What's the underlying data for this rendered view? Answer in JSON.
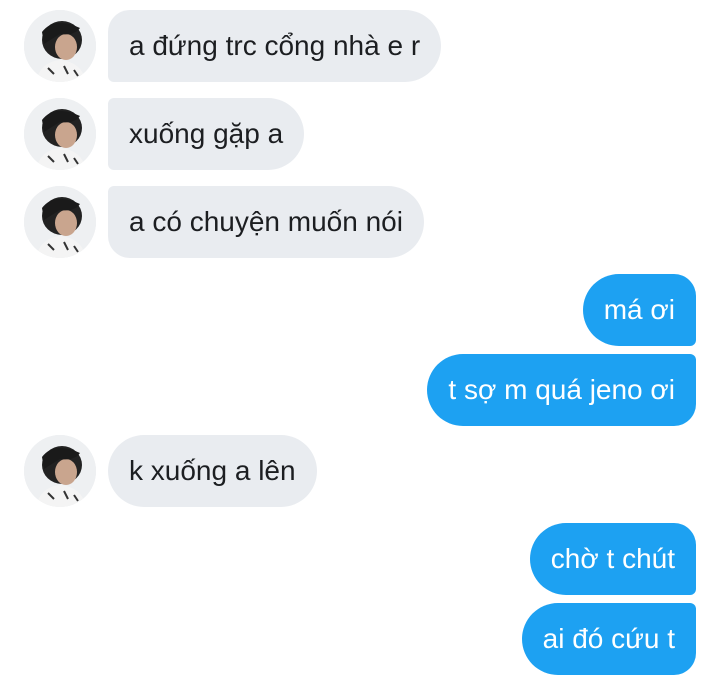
{
  "colors": {
    "incoming_bubble": "#e9ecf0",
    "incoming_text": "#1c1e21",
    "outgoing_bubble": "#1da1f2",
    "outgoing_text": "#ffffff"
  },
  "contact": {
    "avatar_icon": "person-photo-icon"
  },
  "messages": [
    {
      "sender": "them",
      "text": "a đứng trc cổng nhà e r"
    },
    {
      "sender": "them",
      "text": "xuống gặp a"
    },
    {
      "sender": "them",
      "text": "a có chuyện muốn nói"
    },
    {
      "sender": "me",
      "text": "má ơi"
    },
    {
      "sender": "me",
      "text": "t sợ m quá jeno ơi"
    },
    {
      "sender": "them",
      "text": "k xuống a lên"
    },
    {
      "sender": "me",
      "text": "chờ t chút"
    },
    {
      "sender": "me",
      "text": "ai đó cứu t"
    }
  ]
}
